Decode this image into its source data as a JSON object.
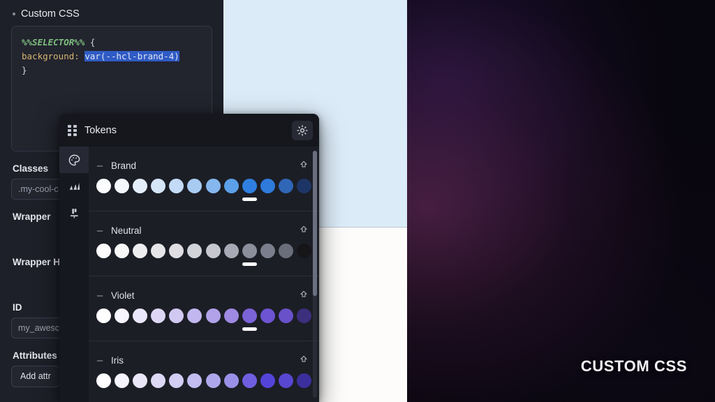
{
  "colors": {
    "panel_bg": "#1e2029",
    "tokens_bg": "#1c1e26",
    "tokens_header_bg": "#15171d",
    "accent_selection": "#2f5bc4",
    "canvas_blue": "#dcebf8",
    "canvas_white": "#fdfcfb",
    "selection_bar": "#ffffff"
  },
  "settings": {
    "custom_css_heading": "Custom CSS",
    "code": {
      "selector": "%%SELECTOR%%",
      "open_brace": " {",
      "property": "background:",
      "value": "var(--hcl-brand-4)",
      "close_brace": "}"
    },
    "fields": [
      {
        "label": "Classes",
        "value": ".my-cool-c",
        "type": "input"
      },
      {
        "label": "Wrapper",
        "value": "",
        "type": "label-only"
      },
      {
        "label": "Wrapper H",
        "value": "",
        "type": "label-only"
      },
      {
        "label": "ID",
        "value": "my_awesc",
        "type": "input"
      },
      {
        "label": "Attributes",
        "value": "Add attr",
        "type": "button"
      }
    ],
    "classes_label": "Classes",
    "classes_value": ".my-cool-c",
    "wrapper_label": "Wrapper",
    "wrapper_h_label": "Wrapper H",
    "id_label": "ID",
    "id_value": "my_awesc",
    "attributes_label": "Attributes",
    "add_attribute_button": "Add attr"
  },
  "tokens_panel": {
    "title": "Tokens",
    "grip_icon": "grip-dots-icon",
    "theme_toggle_icon": "sun-icon",
    "rail": [
      {
        "name": "palette-icon",
        "label": "Colors",
        "active": true
      },
      {
        "name": "type-scale-icon",
        "label": "Type scale",
        "active": false
      },
      {
        "name": "spacing-icon",
        "label": "Spacing",
        "active": false
      }
    ],
    "ramps": [
      {
        "name": "Brand",
        "collapse_icon": "minus-icon",
        "export_icon": "arrow-up-icon",
        "selected_index": 8,
        "swatches": [
          "#fdfeff",
          "#f4f8fd",
          "#e4eefb",
          "#d5e6f9",
          "#c3dbf6",
          "#a8cbf2",
          "#86b7ee",
          "#5ba0e8",
          "#2f7fe0",
          "#2e7adb",
          "#2f66b6",
          "#1d3566"
        ]
      },
      {
        "name": "Neutral",
        "collapse_icon": "minus-icon",
        "export_icon": "arrow-up-icon",
        "selected_index": 8,
        "swatches": [
          "#fdfdfd",
          "#f7f7f8",
          "#eeeef0",
          "#e6e6e9",
          "#dedee2",
          "#d2d3d8",
          "#c7c8cf",
          "#a7a9b4",
          "#8b8e9b",
          "#7b7e8c",
          "#6a6d7a",
          "#161619"
        ]
      },
      {
        "name": "Violet",
        "collapse_icon": "minus-icon",
        "export_icon": "arrow-up-icon",
        "selected_index": 8,
        "swatches": [
          "#ffffff",
          "#f7f5fd",
          "#eae6f9",
          "#ddd7f5",
          "#d1c9f2",
          "#c2b7ee",
          "#b1a2e9",
          "#9f8ae3",
          "#7b63d8",
          "#6d54d2",
          "#6951c9",
          "#3c2f7e"
        ]
      },
      {
        "name": "Iris",
        "collapse_icon": "minus-icon",
        "export_icon": "arrow-up-icon",
        "selected_index": -1,
        "swatches": [
          "#ffffff",
          "#f6f4fc",
          "#e9e6f8",
          "#ddd9f5",
          "#d2cdf3",
          "#c2bcf0",
          "#afa7ec",
          "#9b90e8",
          "#6f5fe0",
          "#5544d8",
          "#5847d0",
          "#3b2f9e"
        ]
      }
    ],
    "scrollbar": {
      "name": "vertical-scrollbar"
    }
  },
  "overlay": {
    "label": "CUSTOM CSS"
  }
}
